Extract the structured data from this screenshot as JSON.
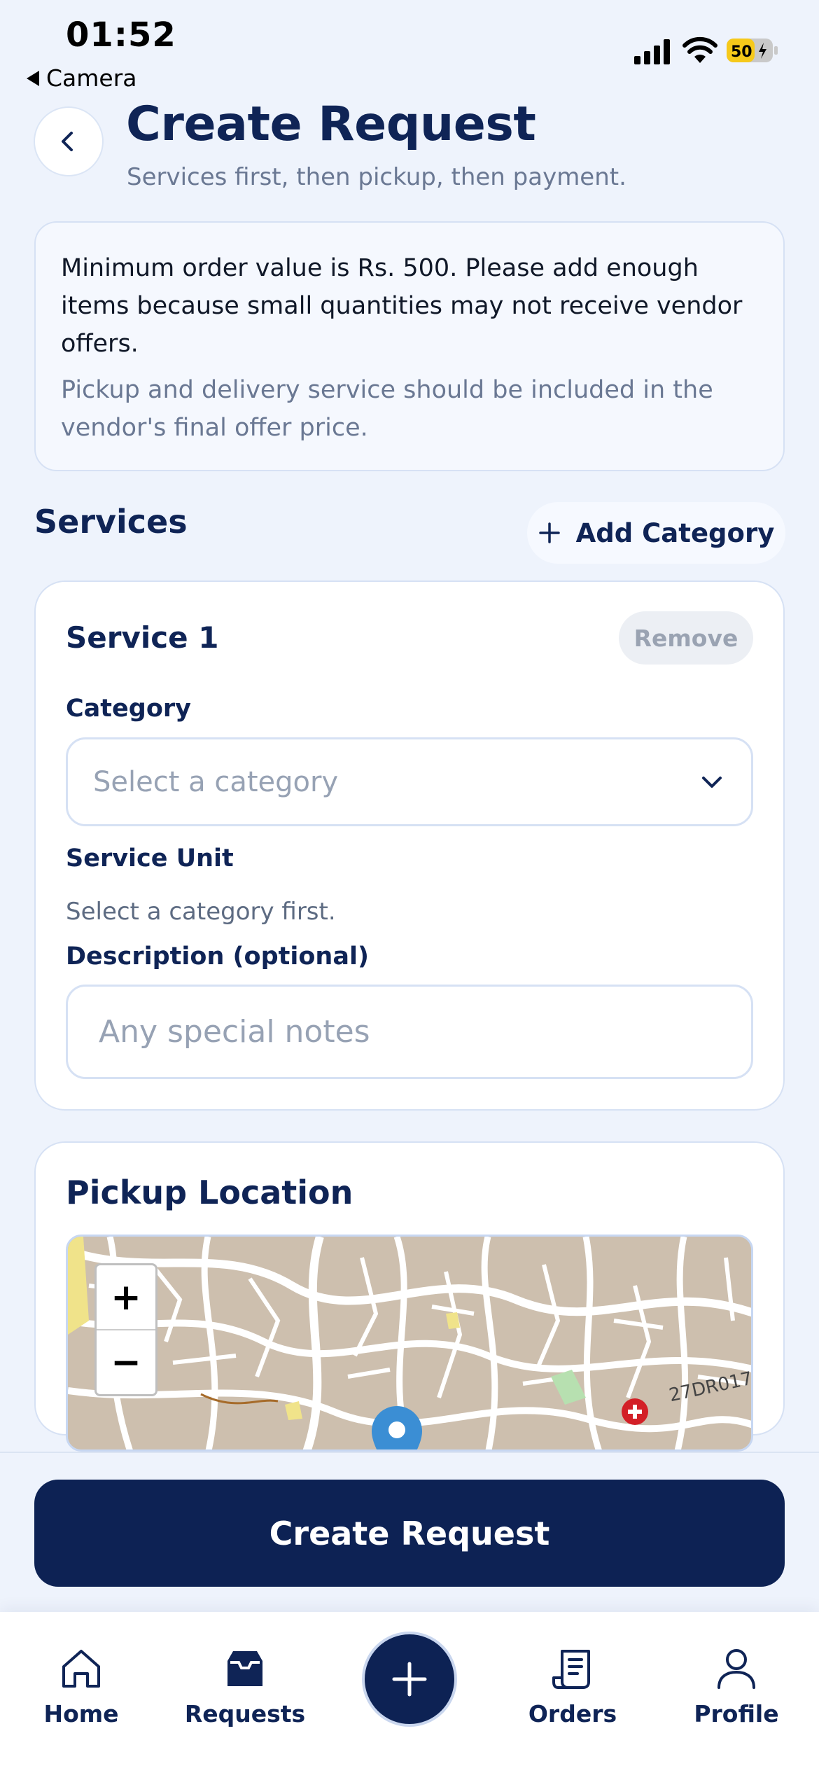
{
  "status_bar": {
    "time": "01:52",
    "back_app": "Camera",
    "battery_level": "50"
  },
  "header": {
    "title": "Create Request",
    "subtitle": "Services first, then pickup, then payment."
  },
  "info": {
    "main": "Minimum order value is Rs. 500. Please add enough items because small quantities may not receive vendor offers.",
    "note": "Pickup and delivery service should be included in the vendor's final offer price."
  },
  "services": {
    "title": "Services",
    "add_label": "Add Category",
    "service": {
      "title": "Service 1",
      "remove_label": "Remove",
      "category_label": "Category",
      "category_placeholder": "Select a category",
      "unit_label": "Service Unit",
      "unit_helper": "Select a category first.",
      "description_label": "Description (optional)",
      "description_placeholder": "Any special notes"
    }
  },
  "pickup": {
    "title": "Pickup Location",
    "zoom_in": "+",
    "zoom_out": "−",
    "map_road_label": "27DR017"
  },
  "submit": {
    "label": "Create Request"
  },
  "tabbar": {
    "items": [
      {
        "label": "Home",
        "icon": "home-icon"
      },
      {
        "label": "Requests",
        "icon": "inbox-icon"
      },
      {
        "label": "",
        "icon": "plus-icon"
      },
      {
        "label": "Orders",
        "icon": "receipt-icon"
      },
      {
        "label": "Profile",
        "icon": "user-icon"
      }
    ]
  },
  "colors": {
    "primary": "#0d2254",
    "background": "#eef3fc",
    "muted_text": "#6a7893",
    "placeholder": "#97a2b4",
    "marker": "#3b8ed4",
    "hospital": "#d32027"
  }
}
